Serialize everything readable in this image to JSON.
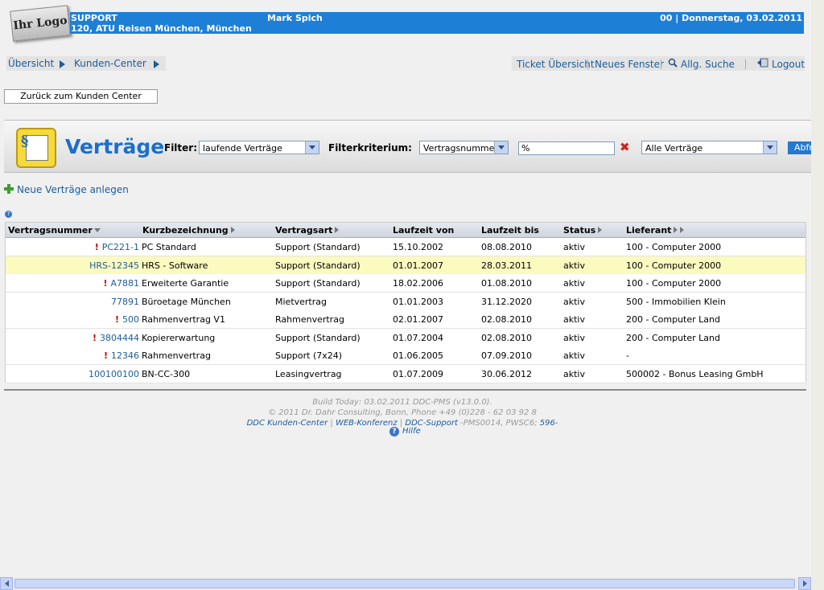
{
  "header": {
    "logo_text": "Ihr Logo",
    "support_label": "SUPPORT",
    "address": "120, ATU Reisen München, München",
    "user": "Mark Spich",
    "date": "00 | Donnerstag, 03.02.2011"
  },
  "breadcrumb": {
    "items": [
      "Übersicht",
      "Kunden-Center"
    ]
  },
  "topnav": {
    "ticket": "Ticket Übersicht",
    "new_window": "Neues Fenster",
    "search": "Allg. Suche",
    "logout": "Logout"
  },
  "back_button": "Zurück zum Kunden Center",
  "page": {
    "title": "Verträge",
    "filter_label": "Filter:",
    "filter_value": "laufende Verträge",
    "criterion_label": "Filterkriterium:",
    "criterion_value": "Vertragsnummer",
    "search_value": "%",
    "scope_value": "Alle Verträge",
    "go_label": "Abfr"
  },
  "new_contracts_link": "Neue Verträge anlegen",
  "table": {
    "columns": [
      "Vertragsnummer",
      "Kurzbezeichnung",
      "Vertragsart",
      "Laufzeit von",
      "Laufzeit bis",
      "Status",
      "Lieferant"
    ],
    "rows": [
      {
        "warn": true,
        "nr": "PC221-1",
        "name": "PC Standard",
        "type": "Support (Standard)",
        "from": "15.10.2002",
        "to": "08.08.2010",
        "status": "aktiv",
        "supplier": "100 - Computer 2000"
      },
      {
        "warn": false,
        "nr": "HRS-12345",
        "name": "HRS - Software",
        "type": "Support (Standard)",
        "from": "01.01.2007",
        "to": "28.03.2011",
        "status": "aktiv",
        "supplier": "100 - Computer 2000"
      },
      {
        "warn": true,
        "nr": "A7881",
        "name": "Erweiterte Garantie",
        "type": "Support (Standard)",
        "from": "18.02.2006",
        "to": "01.08.2010",
        "status": "aktiv",
        "supplier": "100 - Computer 2000"
      },
      {
        "warn": false,
        "nr": "77891",
        "name": "Büroetage München",
        "type": "Mietvertrag",
        "from": "01.01.2003",
        "to": "31.12.2020",
        "status": "aktiv",
        "supplier": "500 - Immobilien Klein"
      },
      {
        "warn": true,
        "nr": "500",
        "name": "Rahmenvertrag V1",
        "type": "Rahmenvertrag",
        "from": "02.01.2007",
        "to": "02.08.2010",
        "status": "aktiv",
        "supplier": "200 - Computer Land"
      },
      {
        "warn": true,
        "nr": "3804444",
        "name": "Kopiererwartung",
        "type": "Support (Standard)",
        "from": "01.07.2004",
        "to": "02.08.2010",
        "status": "aktiv",
        "supplier": "200 - Computer Land"
      },
      {
        "warn": true,
        "nr": "12346",
        "name": "Rahmenvertrag",
        "type": "Support (7x24)",
        "from": "01.06.2005",
        "to": "07.09.2010",
        "status": "aktiv",
        "supplier": "-"
      },
      {
        "warn": false,
        "nr": "100100100",
        "name": "BN-CC-300",
        "type": "Leasingvertrag",
        "from": "01.07.2009",
        "to": "30.06.2012",
        "status": "aktiv",
        "supplier": "500002 - Bonus Leasing GmbH"
      }
    ]
  },
  "footer": {
    "build": "Build Today: 03.02.2011 DDC-PMS (v13.0.0).",
    "copyright": "© 2011 Dr. Dahr Consulting, Bonn, Phone +49 (0)228 - 62 03 92 8",
    "link_center": "DDC Kunden-Center",
    "link_conf": "WEB-Konferenz",
    "link_support": "DDC-Support",
    "support_suffix": "-PMS0014, PWSC6;",
    "support_num": "596-",
    "help": "Hilfe"
  },
  "colors": {
    "header_blue": "#1e7fd6",
    "link_blue": "#1e5c98",
    "highlight_row": "#fbfabf"
  }
}
